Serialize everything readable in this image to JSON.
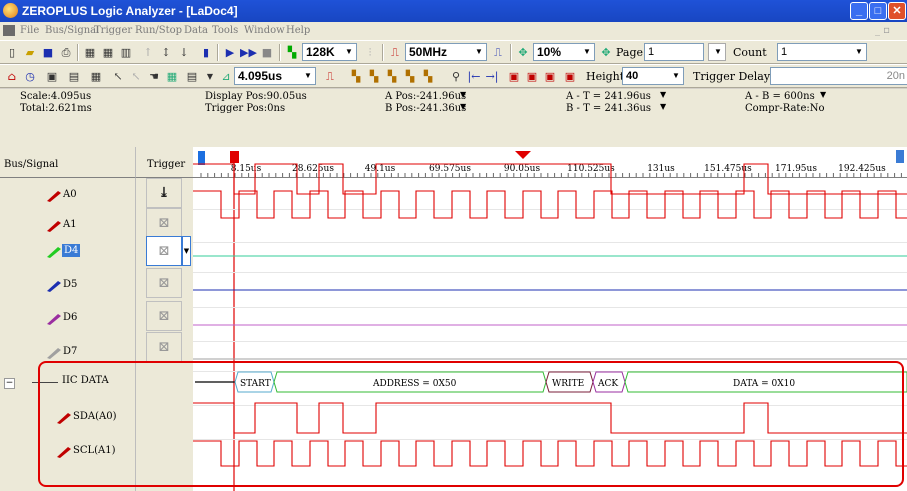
{
  "window": {
    "title": "ZEROPLUS Logic Analyzer - [LaDoc4]"
  },
  "menu": [
    "File",
    "Bus/Signal",
    "Trigger",
    "Run/Stop",
    "Data",
    "Tools",
    "Window",
    "Help"
  ],
  "toolbar1": {
    "memory": "128K",
    "sample_rate": "50MHz",
    "zoom": "10%",
    "page_label": "Page",
    "page_value": "1",
    "count_label": "Count",
    "count_value": "1"
  },
  "toolbar2": {
    "time_per_div": "4.095us",
    "height_label": "Height",
    "height_value": "40",
    "trigger_delay_label": "Trigger Delay",
    "trigger_delay_value": "20n"
  },
  "info": {
    "scale": "Scale:4.095us",
    "total": "Total:2.621ms",
    "display_pos": "Display Pos:90.05us",
    "trigger_pos": "Trigger Pos:0ns",
    "a_pos": "A Pos:-241.96us",
    "b_pos": "B Pos:-241.36us",
    "a_t": "A - T = 241.96us",
    "b_t": "B - T = 241.36us",
    "a_b": "A - B = 600ns",
    "compr": "Compr-Rate:No"
  },
  "columns": {
    "signal": "Bus/Signal",
    "trigger": "Trigger"
  },
  "ruler": [
    "8.15us",
    "28.625us",
    "49.1us",
    "69.575us",
    "90.05us",
    "110.525us",
    "131us",
    "151.475us",
    "171.95us",
    "192.425us"
  ],
  "signals": [
    {
      "name": "A0",
      "color": "#c00000"
    },
    {
      "name": "A1",
      "color": "#c00000"
    },
    {
      "name": "D4",
      "color": "#22cc22"
    },
    {
      "name": "D5",
      "color": "#1c2fb0"
    },
    {
      "name": "D6",
      "color": "#9a2ea0"
    },
    {
      "name": "D7",
      "color": "#a0a0a0"
    }
  ],
  "bus": {
    "name": "IIC DATA",
    "children": [
      "SDA(A0)",
      "SCL(A1)"
    ]
  },
  "decode": [
    "START",
    "ADDRESS = 0X50",
    "WRITE",
    "ACK",
    "DATA = 0X10"
  ],
  "colors": {
    "title_bar": "#1f52d8",
    "highlight": "#e00000",
    "wave": "#e00000"
  }
}
